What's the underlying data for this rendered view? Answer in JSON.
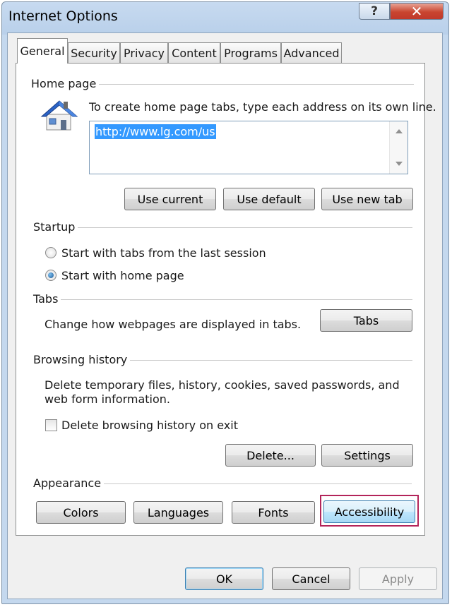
{
  "window": {
    "title": "Internet Options",
    "help_glyph": "?",
    "close_glyph": "✕"
  },
  "tabs": [
    {
      "label": "General",
      "active": true
    },
    {
      "label": "Security"
    },
    {
      "label": "Privacy"
    },
    {
      "label": "Content"
    },
    {
      "label": "Programs"
    },
    {
      "label": "Advanced"
    }
  ],
  "home_page": {
    "group_label": "Home page",
    "icon": "house-icon",
    "instructions": "To create home page tabs, type each address on its own line.",
    "url_value": "http://www.lg.com/us",
    "buttons": {
      "use_current": "Use current",
      "use_default": "Use default",
      "use_new_tab": "Use new tab"
    }
  },
  "startup": {
    "group_label": "Startup",
    "options": [
      {
        "label": "Start with tabs from the last session",
        "selected": false
      },
      {
        "label": "Start with home page",
        "selected": true
      }
    ]
  },
  "tabs_group": {
    "group_label": "Tabs",
    "description": "Change how webpages are displayed in tabs.",
    "button": "Tabs"
  },
  "browsing_history": {
    "group_label": "Browsing history",
    "description_line1": "Delete temporary files, history, cookies, saved passwords, and",
    "description_line2": "web form information.",
    "checkbox_label": "Delete browsing history on exit",
    "checkbox_checked": false,
    "delete_button": "Delete...",
    "settings_button": "Settings"
  },
  "appearance": {
    "group_label": "Appearance",
    "buttons": {
      "colors": "Colors",
      "languages": "Languages",
      "fonts": "Fonts",
      "accessibility": "Accessibility"
    },
    "highlight_color": "#b3245a"
  },
  "footer": {
    "ok": "OK",
    "cancel": "Cancel",
    "apply": "Apply"
  }
}
